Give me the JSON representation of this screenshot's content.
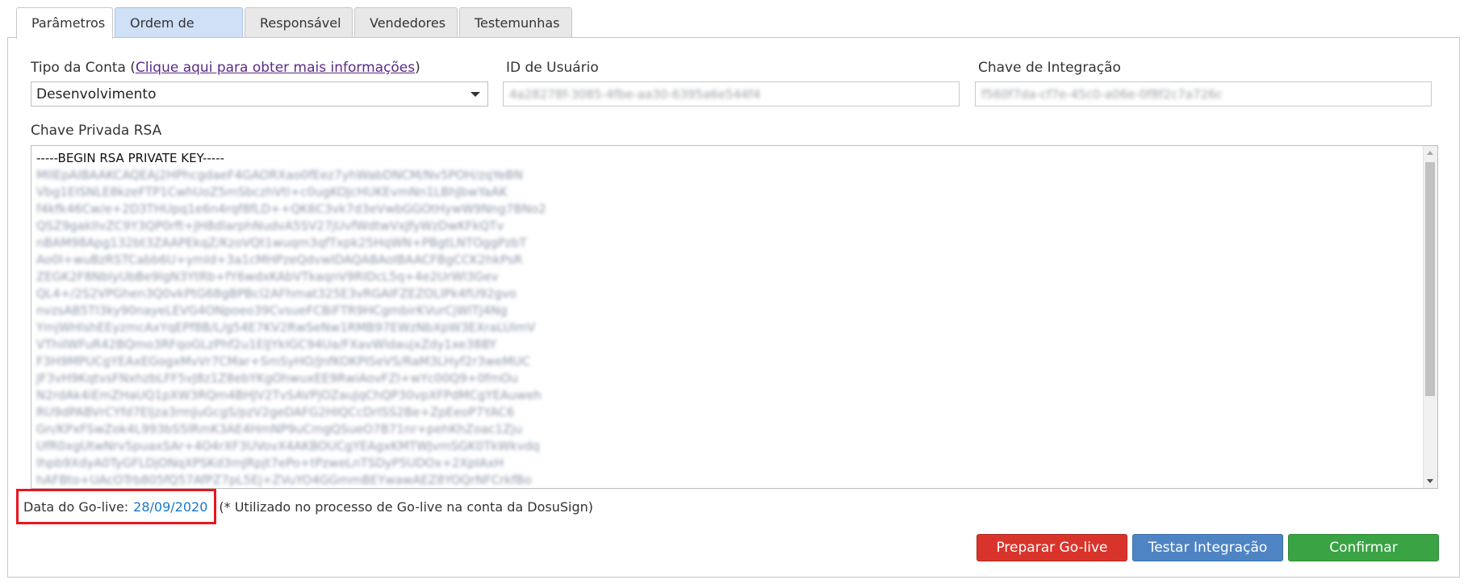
{
  "tabs": [
    {
      "label": "Parâmetros",
      "active": true
    },
    {
      "label": "Ordem de Envio",
      "active": false
    },
    {
      "label": "Responsável",
      "active": false
    },
    {
      "label": "Vendedores",
      "active": false
    },
    {
      "label": "Testemunhas",
      "active": false
    }
  ],
  "account_type": {
    "label": "Tipo da Conta",
    "open_paren": "(",
    "link_text": "Clique aqui para obter mais informações",
    "close_paren": ")",
    "selected": "Desenvolvimento"
  },
  "user_id": {
    "label": "ID de Usuário",
    "value": "4a28278f-3085-4fbe-aa30-6395a6e544f4"
  },
  "integration_key": {
    "label": "Chave de Integração",
    "value": "f560f7da-cf7e-45c0-a06e-0f8f2c7a726c"
  },
  "rsa_key": {
    "label": "Chave Privada RSA",
    "header": "-----BEGIN RSA PRIVATE KEY-----",
    "lines": [
      "MIIEpAIBAAKCAQEAj2HPhcgdaeF4GAORXao0fEez7yhWabDNCM/Nv5POH/zqYeBN",
      "Vbg1EISNLE8kzeFTP1CwhUoZ5mSbczhVtl+c0ugKOJcHUKEvmNn1LBhJbwYaAK",
      "f4kfk46Cw/e+2D3THUpq1e6n4rqf8fLD++QK6C3vk7d3eVwbGGOtHywW9Nng7BNo2",
      "QSZ9gakIIvZC9Y3QP0rft+JH8dlarphNudvA5SV27jUvfWdtwVxJfyWzDwKFkQTv",
      "nBAM98Apg132bt3ZAAPEkqZ/KzoVQt1wuqm3qfTxpk25HqWN+PBgtLNTOggPzbT",
      "Ao0I+wuBzRSTCabb6U+ymId+3a1cMHPzeQdvwIDAQABAoIBAACFBgCCK2hkPsR",
      "ZEGK2F8NblyUbBe9lgN3YtRb+fY6wdxKAbVTkaqnV9RIDcL5q+4e2UrWl3Gev",
      "QL4+/2S2VPGhen3Q0vkPtG68gBPBcl2AFhmat325E3vRGAIFZEZOLIPk4fU92gvo",
      "nvzsAB5TI3ky90nayeLEVG4ONpoeo39CvsueFCBiFTR9HCgmbirKVurCjWlTJ4Ng",
      "YmjWHlshEEyzmcAxYqEPf8B/L/g54E7KV2RwSeNw1RMB97EWzNbXpW3EXraLUlmV",
      "VThiIWFuR42BQmo3RFqoGLzPhf2u1ElJYkIGC94Ua/FXavWldaujxZdy1xe38BY",
      "F3H9MPUCgYEAxEGogxMvVr7CMar+SmSyHO/JnfKOKPISeVS/RaM3LHyf2r3weMUC",
      "JF3vH9KqtvsFNxhzbLFF5vJ8z1Z8ebYKgOhwuxEE9RwiAovFZI+wYc00Q9+0fmOu",
      "N2rdAk4iEmZHaUQ1pXW3RQm4BHJV2TvSAVPjOZauJqChQP30vpXFPdMCgYEAuweh",
      "RU9dPABVrCYfd7Eljza3rmJuGcgS/pzV2geDAFG2HIQCcDrISS2Be+ZpEeoP7YAC6",
      "Gn/KPxFSwZok4L993bS5lRmK3AE4HmNP9uCmgQSueO7B71nr+pehKhZoac1Zju",
      "UfR0xgUtwNrv5puaxSAr+4O4rXF3UVovX4AKBOUCgYEAgxKMTWJvmSGK0TkWkvdq",
      "Ihpb9XdyA0TyGFLDjONqXPSKd3mJRpjt7ePo+tPzweLnTSDyP5UDOx+2XpIAxH",
      "hAFBto+UAcOTrb805fQ57AfPZ7pL5Ej+ZVuYO4GGmmBEYwawAEZ8YOQrNFCrkfBo"
    ]
  },
  "golive": {
    "label": "Data do Go-live:",
    "date": "28/09/2020",
    "note": "(* Utilizado no processo de Go-live na conta da DosuSign)"
  },
  "buttons": {
    "prepare": "Preparar Go-live",
    "test": "Testar Integração",
    "confirm": "Confirmar"
  },
  "colors": {
    "prepare": "#d9342b",
    "test": "#4f84c4",
    "confirm": "#3aa344",
    "highlight_box": "#e8161e",
    "date": "#1a77c8"
  }
}
